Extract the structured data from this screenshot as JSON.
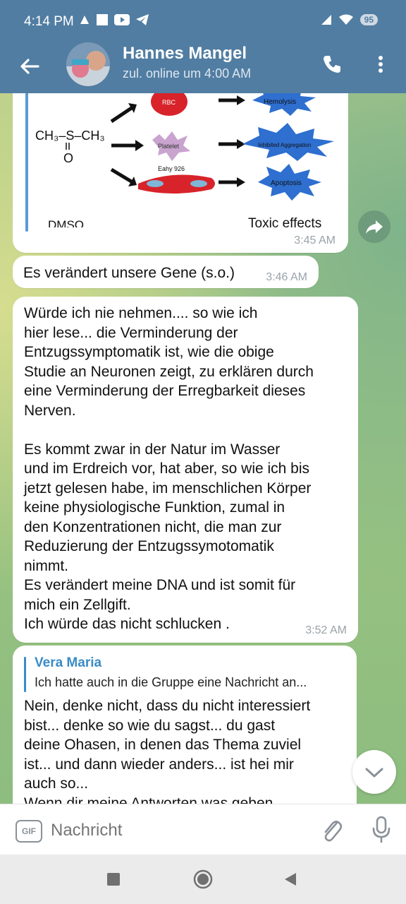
{
  "status": {
    "time": "4:14 PM",
    "battery": "95"
  },
  "header": {
    "title": "Hannes Mangel",
    "subtitle": "zul. online um 4:00 AM"
  },
  "messages": [
    {
      "image_labels": {
        "rbc": "RBC",
        "platelet": "Platelet",
        "eahy": "Eahy 926",
        "hemolysis": "Hemolysis",
        "aggregation": "Inhibited Aggregation",
        "apoptosis": "Apoptosis",
        "dmso": "DMSO",
        "toxic": "Toxic effects",
        "formula_top": "CH₃–S–CH₃",
        "formula_o": "O"
      },
      "time": "3:45 AM"
    },
    {
      "text": "Es verändert unsere Gene (s.o.)",
      "time": "3:46 AM"
    },
    {
      "lines": [
        "Würde ich nie nehmen.... so wie ich",
        "hier lese... die Verminderung der",
        "Entzugssymptomatik ist, wie die obige",
        "Studie an Neuronen zeigt, zu erklären durch",
        "eine Verminderung der Erregbarkeit dieses",
        "Nerven.",
        "",
        "Es kommt zwar in der Natur im Wasser",
        "und im Erdreich vor, hat aber, so wie ich bis",
        "jetzt gelesen habe, im menschlichen Körper",
        "keine physiologische Funktion, zumal in",
        "den Konzentrationen nicht, die man zur",
        "Reduzierung der Entzugssymotomatik",
        "nimmt.",
        "Es verändert meine DNA und ist somit für",
        "mich ein Zellgift.",
        "Ich würde das nicht schlucken ."
      ],
      "time": "3:52 AM"
    },
    {
      "reply_name": "Vera Maria",
      "reply_text": "Ich hatte auch in die Gruppe eine Nachricht an...",
      "lines": [
        "Nein, denke nicht, dass du nicht interessiert",
        "bist... denke so wie du sagst... du gast",
        "deine Ohasen, in denen das Thema zuviel",
        "ist... und dann wieder anders... ist hei mir",
        "auch so...",
        "Wenn dir meine Antworten was geben"
      ]
    }
  ],
  "input": {
    "gif_label": "GIF",
    "placeholder": "Nachricht"
  },
  "colors": {
    "header": "#517da2",
    "link": "#3a8cc6"
  }
}
